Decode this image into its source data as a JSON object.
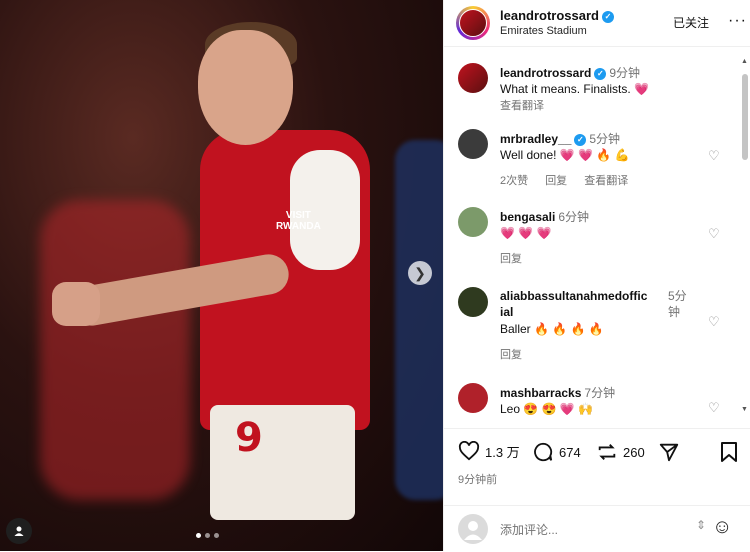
{
  "post": {
    "user": "leandrotrossard",
    "location": "Emirates Stadium",
    "follow_label": "已关注",
    "more_label": "···",
    "photo": {
      "shirt_number": "9",
      "sponsor_line1": "VISIT",
      "sponsor_line2": "RWANDA",
      "carousel_dots": 3,
      "active_dot": 1
    },
    "caption": {
      "user": "leandrotrossard",
      "time": "9分钟",
      "text": "What it means. Finalists. 💗",
      "see_translation": "查看翻译"
    },
    "comments": [
      {
        "user": "mrbradley__",
        "verified": true,
        "time": "5分钟",
        "text": "Well done! 💗 💗 🔥 💪",
        "likes": "2次赞",
        "reply": "回复",
        "see_translation": "查看翻译"
      },
      {
        "user": "bengasali",
        "verified": false,
        "time": "6分钟",
        "text": "💗 💗 💗",
        "likes": "",
        "reply": "回复",
        "see_translation": ""
      },
      {
        "user": "aliabbassultanahmedoffic",
        "user_line2": "ial",
        "verified": false,
        "time": "5分钟",
        "text": "Baller 🔥 🔥 🔥 🔥",
        "likes": "",
        "reply": "回复",
        "see_translation": ""
      },
      {
        "user": "mashbarracks",
        "verified": false,
        "time": "7分钟",
        "text": "Leo 😍 😍 💗 🙌",
        "likes": "",
        "reply": "",
        "see_translation": ""
      }
    ],
    "actions": {
      "likes": "1.3 万",
      "comments": "674",
      "reposts": "260"
    },
    "time_ago": "9分钟前",
    "composer_placeholder": "添加评论...",
    "colors": {
      "verified": "#1d9bf0",
      "arsenal_red": "#c1121f"
    }
  }
}
